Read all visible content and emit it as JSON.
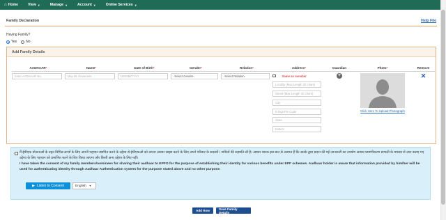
{
  "nav": {
    "home": "Home",
    "items": [
      "View",
      "Manage",
      "Account",
      "Online Services"
    ]
  },
  "page": {
    "title": "Family Declaration",
    "help_link": "Help File",
    "having_family_label": "Having Family?",
    "radio_yes": "Yes",
    "radio_no": "No",
    "selected": "Yes"
  },
  "panel": {
    "title": "Add Family Details",
    "columns": [
      "AADHAAR",
      "Name",
      "Date of Birth",
      "Gender",
      "Relation",
      "Address",
      "Guardian",
      "Photo",
      "Remove"
    ],
    "placeholders": {
      "aadhaar": "Enter AADHAAR No.",
      "name": "Max 85 characters",
      "dob": "DD/MM/YYYY",
      "gender": "-Select Gender-",
      "relation": "-Select Relation-",
      "same_as_member": "Same as member",
      "address_fields": [
        "Locality (Max Length 30 chars)",
        "Street (Max Length 30 chars)",
        "City",
        "6 Digit Pin Code",
        "State",
        "District"
      ]
    },
    "upload_photo": "Click Here To Upload Photograph"
  },
  "consent": {
    "hindi": "मैं ईपीएफ योजनाओं के तहत विभिन्न लाभों के लिए अपनी पहचान स्थापित करने के उद्देश्य से ईपीएफओ को अपना आधार साझा करने के लिए अपने परिवार के सदस्यों / नामितों की सहमति ली है। आधार धारक इस बात से अवगत है कि उसके द्वारा प्रदान की गई जानकारी का उपयोग आधार प्रमाणीकरण प्रणाली के माध्यम से उपर बताए गए उद्देश्य के लिए पहचान को प्रमाणित करने के लिए किया जाएगा और किसी अन्य उद्देश्य के लिए नहीं।",
    "english": "I have taken the consent of my family members/nominees for sharing their aadhaar to EPFO for the purpose of establishing their identity for various benefits under EPF schemes. Aadhaar holder is aware that information provided by him/her will be used for authenticating identity through Aadhaar Authentication system for the purpose stated above and no other purpose.",
    "listen_label": "Listen to Consent",
    "language": "English"
  },
  "actions": {
    "add_row": "Add Row",
    "save": "Save Family Details"
  },
  "colors": {
    "nav_bg": "#1f6b55",
    "accent_border": "#e0b58d",
    "button_bg": "#1d4e8f",
    "consent_bg": "#d9f0fb",
    "listen_bg": "#0d8fd9",
    "required_star": "#d9534f"
  },
  "icons": [
    "home-icon",
    "caret-down-icon",
    "plus-circle-icon",
    "close-icon",
    "avatar-placeholder-icon",
    "play-icon"
  ]
}
